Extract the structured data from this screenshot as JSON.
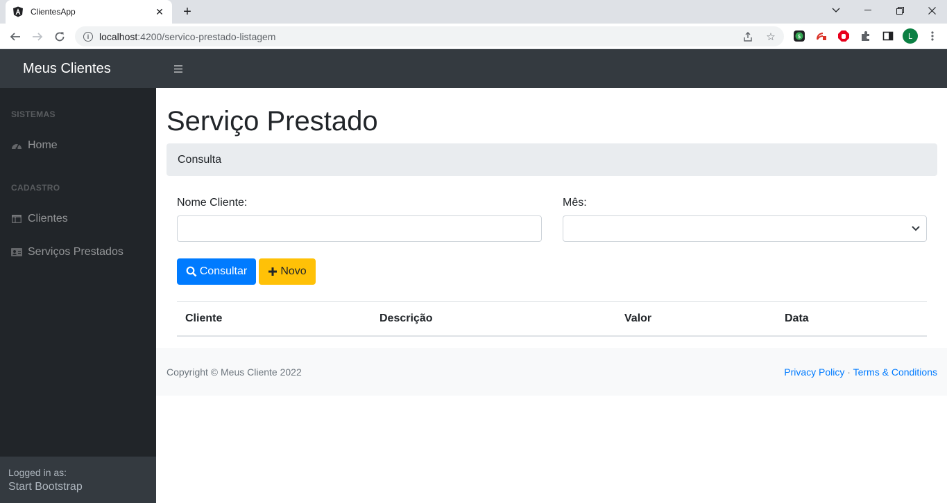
{
  "browser": {
    "tab_title": "ClientesApp",
    "url_host": "localhost",
    "url_path": ":4200/servico-prestado-listagem"
  },
  "app": {
    "brand": "Meus Clientes"
  },
  "sidebar": {
    "sections": [
      {
        "heading": "SISTEMAS",
        "items": [
          {
            "label": "Home",
            "icon": "tachometer-icon"
          }
        ]
      },
      {
        "heading": "CADASTRO",
        "items": [
          {
            "label": "Clientes",
            "icon": "table-icon"
          },
          {
            "label": "Serviços Prestados",
            "icon": "id-card-icon"
          }
        ]
      }
    ],
    "footer": {
      "logged_in_label": "Logged in as:",
      "user": "Start Bootstrap"
    }
  },
  "main": {
    "title": "Serviço Prestado",
    "breadcrumb": "Consulta",
    "form": {
      "nome_label": "Nome Cliente:",
      "nome_value": "",
      "mes_label": "Mês:",
      "mes_value": ""
    },
    "buttons": {
      "consultar": "Consultar",
      "novo": "Novo"
    },
    "table": {
      "headers": [
        "Cliente",
        "Descrição",
        "Valor",
        "Data"
      ],
      "rows": []
    }
  },
  "footer": {
    "copyright": "Copyright © Meus Cliente 2022",
    "privacy": "Privacy Policy",
    "separator": "·",
    "terms": "Terms & Conditions"
  },
  "colors": {
    "primary": "#007bff",
    "warning": "#ffc107",
    "sidebar_dark": "#212529",
    "topbar_dark": "#343a40"
  }
}
